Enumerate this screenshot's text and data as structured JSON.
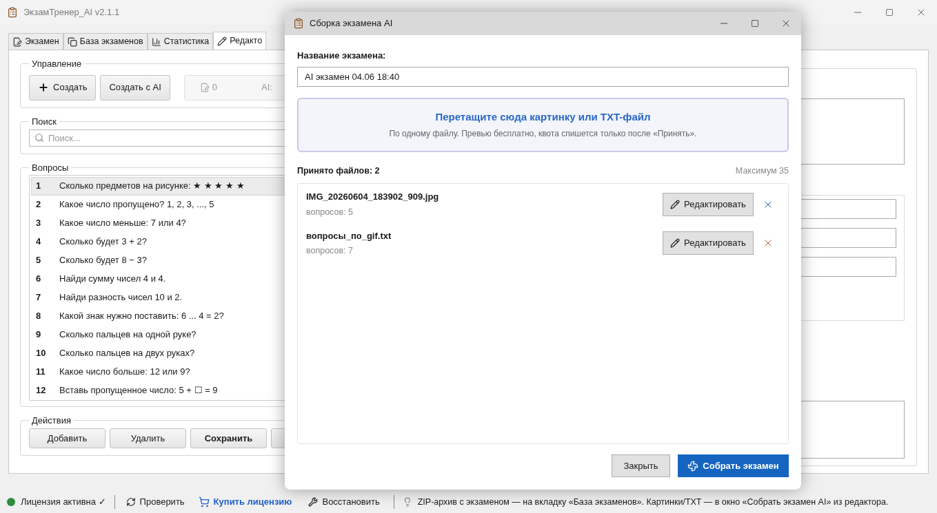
{
  "window": {
    "title": "ЭкзамТренер_AI v2.1.1"
  },
  "tabs": [
    {
      "label": "Экзамен",
      "selected": false
    },
    {
      "label": "База экзаменов",
      "selected": false
    },
    {
      "label": "Статистика",
      "selected": false
    },
    {
      "label": "Редакто",
      "selected": true
    }
  ],
  "control_group": {
    "title": "Управление",
    "buttons": [
      {
        "label": "Создать"
      },
      {
        "label": "Создать с AI"
      }
    ],
    "counter": "0",
    "ai_label": "AI:"
  },
  "search_group": {
    "title": "Поиск",
    "placeholder": "Поиск..."
  },
  "questions_group": {
    "title": "Вопросы",
    "rows": [
      {
        "number": "1",
        "text": "Сколько предметов на рисунке: ★ ★ ★ ★ ★",
        "selected": true
      },
      {
        "number": "2",
        "text": "Какое число пропущено? 1, 2, 3, ..., 5",
        "selected": false
      },
      {
        "number": "3",
        "text": "Какое число меньше: 7 или 4?",
        "selected": false
      },
      {
        "number": "4",
        "text": "Сколько будет 3 + 2?",
        "selected": false
      },
      {
        "number": "5",
        "text": "Сколько будет 8 − 3?",
        "selected": false
      },
      {
        "number": "6",
        "text": "Найди сумму чисел 4 и 4.",
        "selected": false
      },
      {
        "number": "7",
        "text": "Найди разность чисел 10 и 2.",
        "selected": false
      },
      {
        "number": "8",
        "text": "Какой знак нужно поставить: 6 ... 4 = 2?",
        "selected": false
      },
      {
        "number": "9",
        "text": "Сколько пальцев на одной руке?",
        "selected": false
      },
      {
        "number": "10",
        "text": "Сколько пальцев на двух руках?",
        "selected": false
      },
      {
        "number": "11",
        "text": "Какое число больше: 12 или 9?",
        "selected": false
      },
      {
        "number": "12",
        "text": "Вставь пропущенное число: 5 + ☐ = 9",
        "selected": false
      }
    ]
  },
  "actions_group": {
    "title": "Действия",
    "buttons": [
      {
        "label": "Добавить",
        "kind": "normal"
      },
      {
        "label": "Удалить",
        "kind": "normal"
      },
      {
        "label": "Сохранить",
        "kind": "primary"
      }
    ]
  },
  "dialog": {
    "title": "Сборка экзамена AI",
    "name_label": "Название экзамена:",
    "name_value": "AI экзамен 04.06 18:40",
    "drop_title": "Перетащите сюда картинку или TXT-файл",
    "drop_hint": "По одному файлу. Превью бесплатно, квота спишется только после «Принять».",
    "accepted": "Принято файлов: 2",
    "maximum": "Максимум 35",
    "files": [
      {
        "name": "IMG_20260604_183902_909.jpg",
        "count": "вопросов: 5",
        "edit": "Редактировать",
        "color": "#1f5fa8"
      },
      {
        "name": "вопросы_по_gif.txt",
        "count": "вопросов: 7",
        "edit": "Редактировать",
        "color": "#b5542a"
      }
    ],
    "buttons": [
      {
        "label": "Закрыть",
        "kind": "secondary"
      },
      {
        "label": "Собрать экзамен",
        "kind": "primary"
      }
    ]
  },
  "status_bar": {
    "license": {
      "text": "Лицензия активна ✓",
      "color": "#2e8b3a"
    },
    "check": "Проверить",
    "buy": "Купить лицензию",
    "restore": "Восстановить",
    "hint": "ZIP-архив с экзаменом — на вкладку «База экзаменов». Картинки/TXT — в окно «Собрать экзамен AI» из редактора."
  }
}
